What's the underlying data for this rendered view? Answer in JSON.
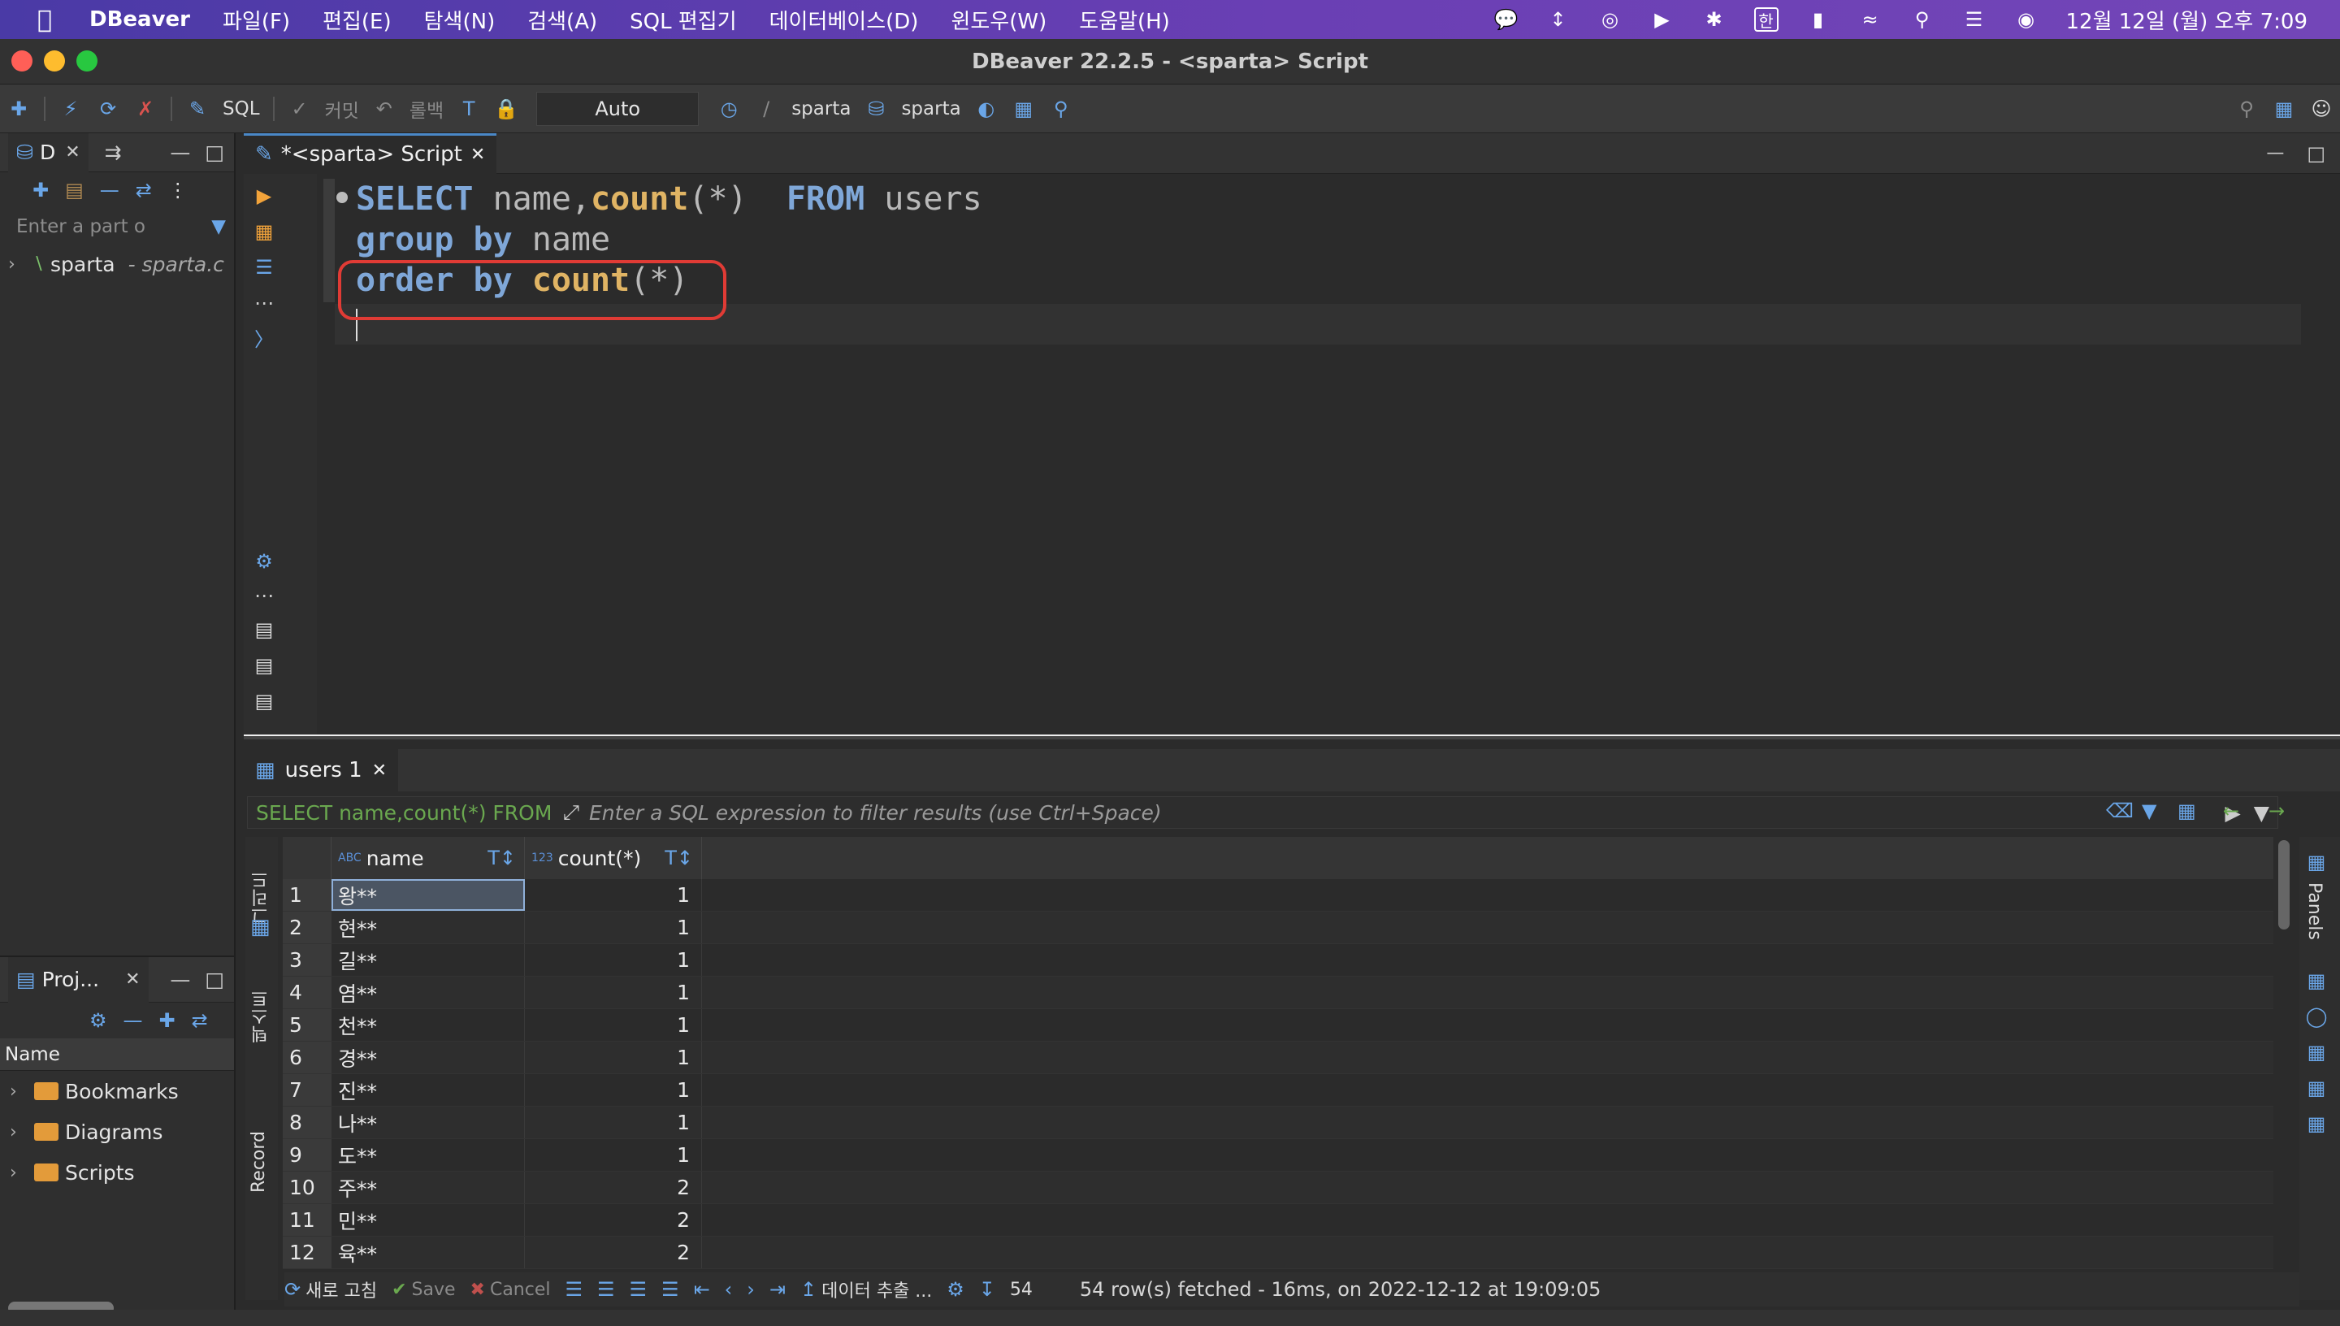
{
  "menubar": {
    "app_name": "DBeaver",
    "items": [
      "파일(F)",
      "편집(E)",
      "탐색(N)",
      "검색(A)",
      "SQL 편집기",
      "데이터베이스(D)",
      "윈도우(W)",
      "도움말(H)"
    ],
    "clock": "12월 12일 (월) 오후 7:09",
    "input_method": "한"
  },
  "window": {
    "title": "DBeaver 22.2.5 - <sparta> Script"
  },
  "toolbar": {
    "sql_label": "SQL",
    "commit_label": "커밋",
    "rollback_label": "롤백",
    "transaction_mode": "Auto",
    "datasource": "sparta",
    "schema": "sparta"
  },
  "navigator": {
    "tab_label": "D",
    "filter_placeholder": "Enter a part o",
    "tree": [
      {
        "label": "sparta",
        "sub": "- sparta.c"
      }
    ]
  },
  "projects": {
    "tab_label": "Proj...",
    "column_header": "Name",
    "items": [
      "Bookmarks",
      "Diagrams",
      "Scripts"
    ]
  },
  "editor": {
    "tab_label": "*<sparta> Script",
    "lines": [
      {
        "kw1": "SELECT",
        "rest1": " name,",
        "fn": "count",
        "rest2": "(*)  ",
        "kw2": "FROM",
        "rest3": " users"
      },
      {
        "kw1": "group by",
        "rest1": " name"
      },
      {
        "kw1": "order by",
        "fn": " count",
        "rest2": "(*)"
      }
    ]
  },
  "results": {
    "tab_label": "users 1",
    "query_preview": "SELECT name,count(*) FROM users",
    "filter_placeholder": "Enter a SQL expression to filter results (use Ctrl+Space)",
    "side_tabs": {
      "grid": "그리드",
      "text": "텍스트",
      "record": "Record"
    },
    "panels_label": "Panels",
    "columns": {
      "type1": "ABC",
      "name": "name",
      "type2": "123",
      "count": "count(*)"
    },
    "rows": [
      {
        "n": "1",
        "name": "왕**",
        "count": "1"
      },
      {
        "n": "2",
        "name": "현**",
        "count": "1"
      },
      {
        "n": "3",
        "name": "길**",
        "count": "1"
      },
      {
        "n": "4",
        "name": "염**",
        "count": "1"
      },
      {
        "n": "5",
        "name": "천**",
        "count": "1"
      },
      {
        "n": "6",
        "name": "경**",
        "count": "1"
      },
      {
        "n": "7",
        "name": "진**",
        "count": "1"
      },
      {
        "n": "8",
        "name": "나**",
        "count": "1"
      },
      {
        "n": "9",
        "name": "도**",
        "count": "1"
      },
      {
        "n": "10",
        "name": "주**",
        "count": "2"
      },
      {
        "n": "11",
        "name": "민**",
        "count": "2"
      },
      {
        "n": "12",
        "name": "육**",
        "count": "2"
      }
    ],
    "toolbar": {
      "refresh": "새로 고침",
      "save": "Save",
      "cancel": "Cancel",
      "export": "데이터 추출 ...",
      "row_count": "54",
      "status": "54 row(s) fetched - 16ms, on 2022-12-12 at 19:09:05"
    }
  }
}
